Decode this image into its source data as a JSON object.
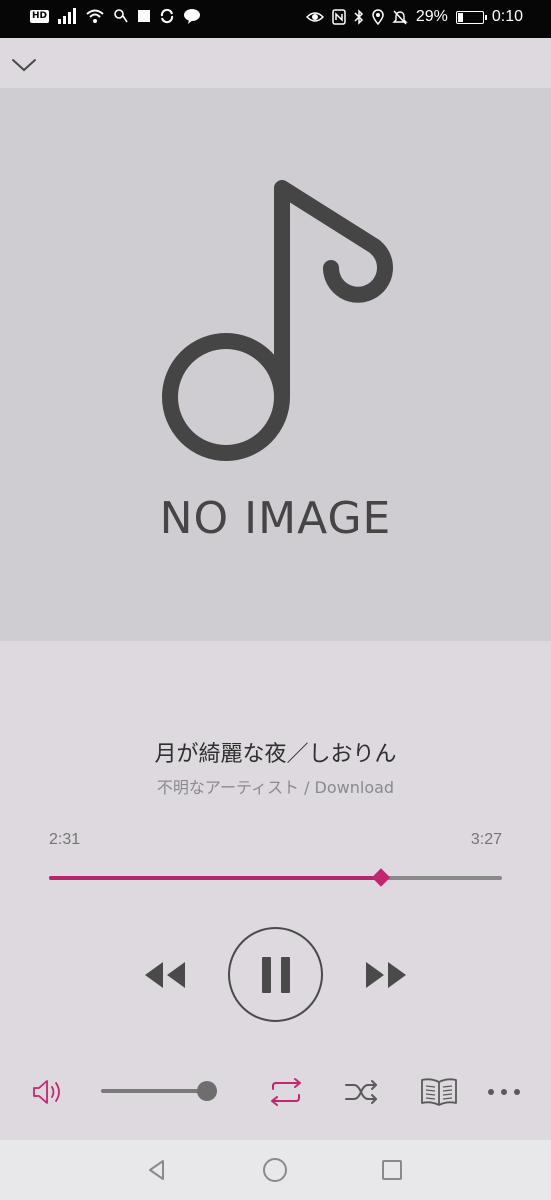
{
  "status_bar": {
    "hd_label": "HD",
    "battery_percent_label": "29%",
    "battery_level": 0.29,
    "time": "0:10",
    "icons": [
      "signal-icon",
      "wifi-icon",
      "notification-icon",
      "stop-icon",
      "sync-icon",
      "line-icon",
      "eye-icon",
      "nfc-icon",
      "bluetooth-icon",
      "location-icon",
      "mute-icon",
      "battery-icon"
    ]
  },
  "artwork": {
    "placeholder_text": "NO IMAGE",
    "icon": "music-note-icon"
  },
  "track": {
    "title": "月が綺麗な夜／しおりん",
    "subtitle": "不明なアーティスト / Download"
  },
  "progress": {
    "elapsed": "2:31",
    "total": "3:27",
    "fraction": 0.733
  },
  "controls": {
    "rewind_icon": "rewind-icon",
    "play_pause_icon": "pause-icon",
    "forward_icon": "fast-forward-icon"
  },
  "toolbar": {
    "volume_icon": "volume-icon",
    "volume_level": 1.0,
    "repeat_icon": "repeat-icon",
    "shuffle_icon": "shuffle-icon",
    "lyrics_icon": "book-icon",
    "more_icon": "more-icon"
  },
  "colors": {
    "accent": "#c2266f",
    "background": "#ddd9de",
    "artwork_bg": "#d0cdd2",
    "icon_dark": "#4a4a4a"
  }
}
